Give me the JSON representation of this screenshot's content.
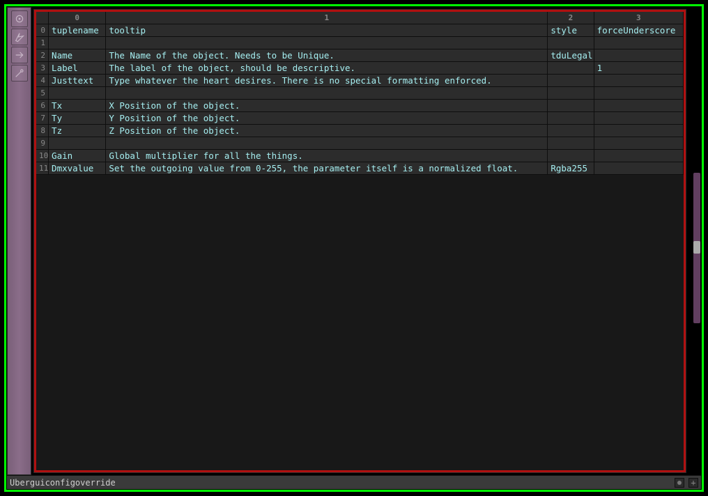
{
  "columns": [
    "0",
    "1",
    "2",
    "3"
  ],
  "rows": [
    {
      "idx": "0",
      "cells": [
        "tuplename",
        "tooltip",
        "style",
        "forceUnderscore"
      ]
    },
    {
      "idx": "1",
      "cells": [
        "",
        "",
        "",
        ""
      ]
    },
    {
      "idx": "2",
      "cells": [
        "Name",
        "The Name of the object. Needs to be Unique.",
        "tduLegal",
        ""
      ]
    },
    {
      "idx": "3",
      "cells": [
        "Label",
        "The label of the object, should be descriptive.",
        "",
        "1"
      ]
    },
    {
      "idx": "4",
      "cells": [
        "Justtext",
        "Type whatever the heart desires. There is no special formatting enforced.",
        "",
        ""
      ]
    },
    {
      "idx": "5",
      "cells": [
        "",
        "",
        "",
        ""
      ]
    },
    {
      "idx": "6",
      "cells": [
        "Tx",
        "X Position of the object.",
        "",
        ""
      ]
    },
    {
      "idx": "7",
      "cells": [
        "Ty",
        "Y Position of the object.",
        "",
        ""
      ]
    },
    {
      "idx": "8",
      "cells": [
        "Tz",
        "Z Position of the object.",
        "",
        ""
      ]
    },
    {
      "idx": "9",
      "cells": [
        "",
        "",
        "",
        ""
      ]
    },
    {
      "idx": "10",
      "cells": [
        "Gain",
        "Global multiplier for all the things.",
        "",
        ""
      ]
    },
    {
      "idx": "11",
      "cells": [
        "Dmxvalue",
        "Set the outgoing value from 0-255, the parameter itself is a normalized float.",
        "Rgba255",
        ""
      ]
    }
  ],
  "status": {
    "title": "Uberguiconfigoverride"
  },
  "toolbar": {
    "icons": [
      "target-icon",
      "bolt-icon",
      "arrow-right-icon",
      "wand-icon"
    ]
  }
}
